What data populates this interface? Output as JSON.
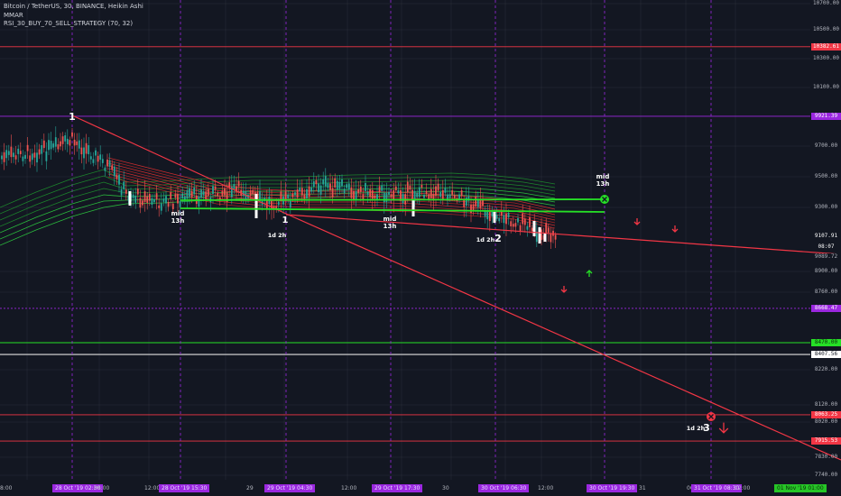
{
  "legend": {
    "title": "Bitcoin / TetherUS, 30, BINANCE, Heikin Ashi",
    "indicator1": "MMAR",
    "indicator2": "RSI_30_BUY_70_SELL_STRATEGY (70, 32)"
  },
  "colors": {
    "background": "#131722",
    "grid": "#2a2e39",
    "red": "#f23645",
    "green": "#26e026",
    "purple": "#9b27e0",
    "white": "#ffffff"
  },
  "chart_data": {
    "type": "candlestick",
    "ylim": [
      7700,
      10700
    ],
    "y_ticks": [
      10700,
      10500,
      10300,
      10100,
      9700,
      9500,
      9300,
      8900,
      8760,
      8220,
      8120,
      8020,
      7830,
      7740
    ],
    "price_labels": [
      {
        "value": "10382.61",
        "style": "red-line"
      },
      {
        "value": "9921.39",
        "style": "purple-line"
      },
      {
        "value": "9107.91",
        "style": "current"
      },
      {
        "value": "08:07",
        "style": "current"
      },
      {
        "value": "9089.72",
        "style": "plain"
      },
      {
        "value": "8668.47",
        "style": "purple-dotted"
      },
      {
        "value": "8470.00",
        "style": "green-line"
      },
      {
        "value": "8407.56",
        "style": "white-line"
      },
      {
        "value": "8063.25",
        "style": "red-line"
      },
      {
        "value": "7915.53",
        "style": "red-line"
      }
    ],
    "horizontal_levels": [
      {
        "price": 10382.61,
        "color": "red",
        "dash": "solid"
      },
      {
        "price": 9921.39,
        "color": "purple",
        "dash": "solid"
      },
      {
        "price": 8668.47,
        "color": "purple",
        "dash": "dotted"
      },
      {
        "price": 8470.0,
        "color": "green",
        "dash": "solid"
      },
      {
        "price": 8407.56,
        "color": "white",
        "dash": "solid"
      },
      {
        "price": 8063.25,
        "color": "red",
        "dash": "solid"
      },
      {
        "price": 7915.53,
        "color": "red",
        "dash": "solid"
      }
    ],
    "time_labels": [
      {
        "text": "8:00",
        "hl": false
      },
      {
        "text": "28 Oct '19  02:30",
        "hl": true
      },
      {
        "text": "06:00",
        "hl": false
      },
      {
        "text": "12:00",
        "hl": false
      },
      {
        "text": "28 Oct '19  15:30",
        "hl": true
      },
      {
        "text": "29",
        "hl": false
      },
      {
        "text": "29 Oct '19  04:30",
        "hl": true
      },
      {
        "text": "12:00",
        "hl": false
      },
      {
        "text": "29 Oct '19  17:30",
        "hl": true
      },
      {
        "text": "30",
        "hl": false
      },
      {
        "text": "30 Oct '19  06:30",
        "hl": true
      },
      {
        "text": "12:00",
        "hl": false
      },
      {
        "text": "30 Oct '19  19:30",
        "hl": true
      },
      {
        "text": "31",
        "hl": false
      },
      {
        "text": "06",
        "hl": false
      },
      {
        "text": "31 Oct '19  08:30",
        "hl": true
      },
      {
        "text": "12:00",
        "hl": false
      },
      {
        "text": "01 Nov '19  01:00",
        "hl": true,
        "green": true
      }
    ],
    "annotations": [
      {
        "text": "1",
        "kind": "wave"
      },
      {
        "text": "mid",
        "kind": "label"
      },
      {
        "text": "13h",
        "kind": "label"
      },
      {
        "text": "1",
        "kind": "wave"
      },
      {
        "text": "1d 2h",
        "kind": "label"
      },
      {
        "text": "mid",
        "kind": "label"
      },
      {
        "text": "13h",
        "kind": "label"
      },
      {
        "text": "1d 2h",
        "kind": "label"
      },
      {
        "text": "2",
        "kind": "wave"
      },
      {
        "text": "mid",
        "kind": "label"
      },
      {
        "text": "13h",
        "kind": "label"
      },
      {
        "text": "1d 2h",
        "kind": "label"
      },
      {
        "text": "3",
        "kind": "wave"
      }
    ]
  }
}
